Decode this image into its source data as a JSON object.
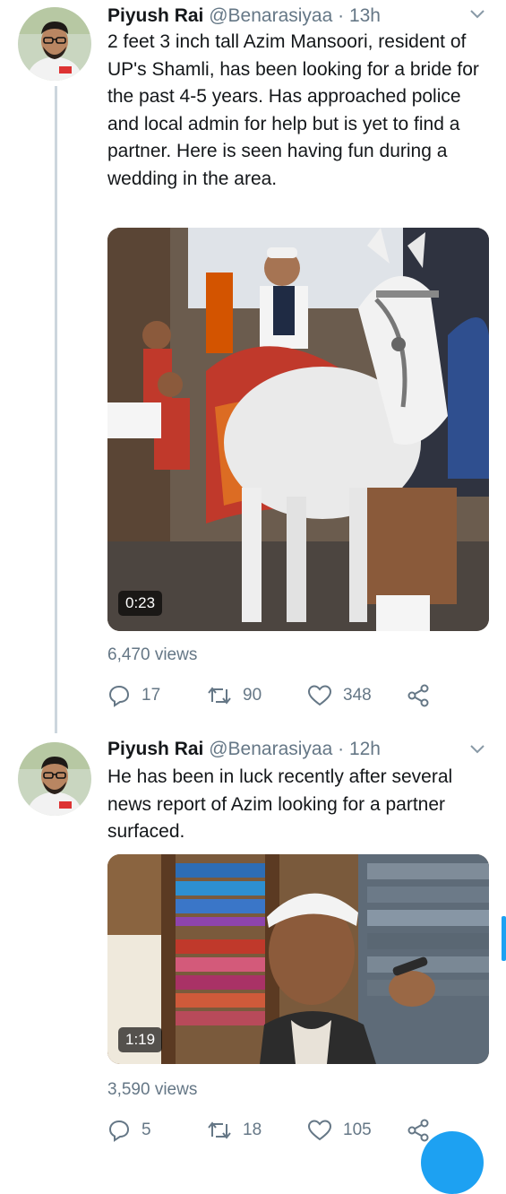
{
  "tweets": [
    {
      "name": "Piyush Rai",
      "handle": "@Benarasiyaa",
      "time": "· 13h",
      "text": "2 feet 3 inch tall Azim Mansoori, resident of UP's Shamli, has been looking for a bride for the past 4-5 years. Has approached police and local admin for help but is yet to find a partner. Here is seen having fun during a wedding in the area.",
      "video_duration": "0:23",
      "views": "6,470 views",
      "replies": "17",
      "retweets": "90",
      "likes": "348"
    },
    {
      "name": "Piyush Rai",
      "handle": "@Benarasiyaa",
      "time": "· 12h",
      "text": "He has been in luck recently after several news report of Azim looking for a partner surfaced.",
      "video_duration": "1:19",
      "views": "3,590 views",
      "replies": "5",
      "retweets": "18",
      "likes": "105"
    }
  ],
  "icons": [
    "chevron-down-icon",
    "reply-icon",
    "retweet-icon",
    "like-icon",
    "share-icon"
  ],
  "colors": {
    "accent": "#1da1f2",
    "text": "#14171a",
    "muted": "#657786",
    "thread_line": "#ccd6dd"
  }
}
